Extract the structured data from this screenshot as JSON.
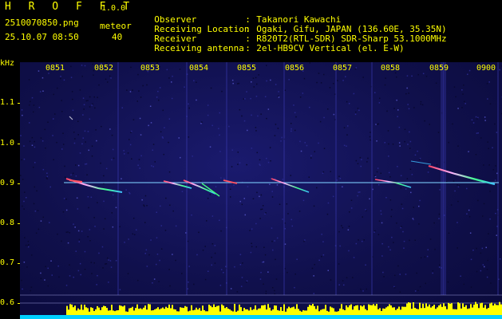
{
  "app": {
    "name": "H R O F F T",
    "version": "1.0.0",
    "filename": "2510070850.png",
    "datetime": "25.10.07 08:50",
    "meteor_label": "meteor",
    "meteor_count": "40"
  },
  "info": {
    "rows": [
      {
        "key": "Observer",
        "colon": ":",
        "value": "Takanori Kawachi"
      },
      {
        "key": "Receiving Location",
        "colon": ":",
        "value": "Ogaki, Gifu, JAPAN (136.60E, 35.35N)"
      },
      {
        "key": "Receiver",
        "colon": ":",
        "value": "R820T2(RTL-SDR) SDR-Sharp 53.1000MHz"
      },
      {
        "key": "Receiving antenna",
        "colon": ":",
        "value": "2el-HB9CV Vertical (el. E-W)"
      }
    ]
  },
  "spectrogram": {
    "y_unit": "kHz",
    "y_ticks": [
      "1.1",
      "1.0",
      "0.9",
      "0.8",
      "0.7",
      "0.6"
    ],
    "time_ticks": [
      "0851",
      "0852",
      "0853",
      "0854",
      "0855",
      "0856",
      "0857",
      "0858",
      "0859",
      "0900"
    ],
    "colors": {
      "background": "#12125a",
      "axis_text": "#ffff00",
      "carrier": "#7fd0ff",
      "meteor_hot": "#ff5060",
      "meteor_mid": "#40ff80",
      "level_bar": "#ffff00",
      "level_base": "#00d0ff"
    }
  }
}
